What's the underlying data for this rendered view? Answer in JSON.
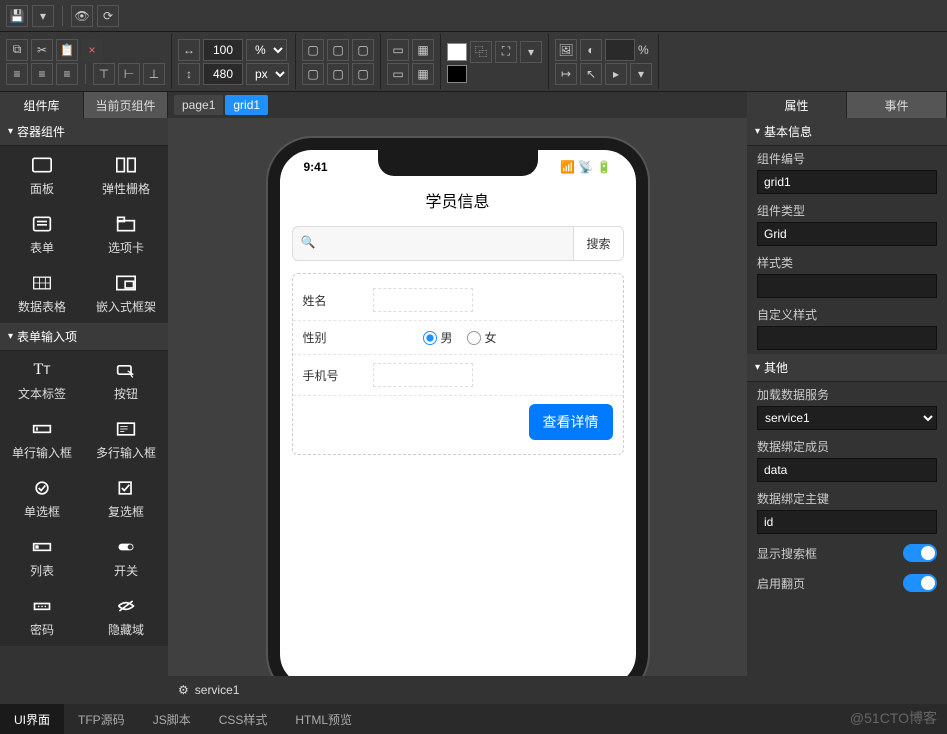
{
  "toolbar": {
    "zoom": "100",
    "zoomUnit": "%",
    "width": "480",
    "widthUnit": "px",
    "pct": "%"
  },
  "leftTabs": {
    "lib": "组件库",
    "current": "当前页组件"
  },
  "sections": {
    "container": "容器组件",
    "formInput": "表单输入项"
  },
  "components": {
    "panel": "面板",
    "flexgrid": "弹性栅格",
    "form": "表单",
    "tabs": "选项卡",
    "datagrid": "数据表格",
    "iframe": "嵌入式框架",
    "label": "文本标签",
    "button": "按钮",
    "textinput": "单行输入框",
    "textarea": "多行输入框",
    "radio": "单选框",
    "checkbox": "复选框",
    "list": "列表",
    "switch": "开关",
    "password": "密码",
    "hidden": "隐藏域"
  },
  "crumbs": {
    "page": "page1",
    "grid": "grid1"
  },
  "phone": {
    "time": "9:41",
    "title": "学员信息",
    "searchPlaceholder": "",
    "searchBtn": "搜索",
    "fields": {
      "name": "姓名",
      "gender": "性别",
      "male": "男",
      "female": "女",
      "phone": "手机号"
    },
    "detailBtn": "查看详情"
  },
  "service": {
    "name": "service1"
  },
  "rightTabs": {
    "props": "属性",
    "events": "事件"
  },
  "propSections": {
    "basic": "基本信息",
    "other": "其他"
  },
  "props": {
    "idLabel": "组件编号",
    "idVal": "grid1",
    "typeLabel": "组件类型",
    "typeVal": "Grid",
    "styleClassLabel": "样式类",
    "styleClassVal": "",
    "customStyleLabel": "自定义样式",
    "customStyleVal": "",
    "loadServiceLabel": "加载数据服务",
    "loadServiceVal": "service1",
    "bindMemberLabel": "数据绑定成员",
    "bindMemberVal": "data",
    "bindKeyLabel": "数据绑定主键",
    "bindKeyVal": "id",
    "showSearchLabel": "显示搜索框",
    "enablePagingLabel": "启用翻页"
  },
  "bottomTabs": {
    "ui": "UI界面",
    "tfp": "TFP源码",
    "js": "JS脚本",
    "css": "CSS样式",
    "html": "HTML预览"
  },
  "watermark": "@51CTO博客"
}
